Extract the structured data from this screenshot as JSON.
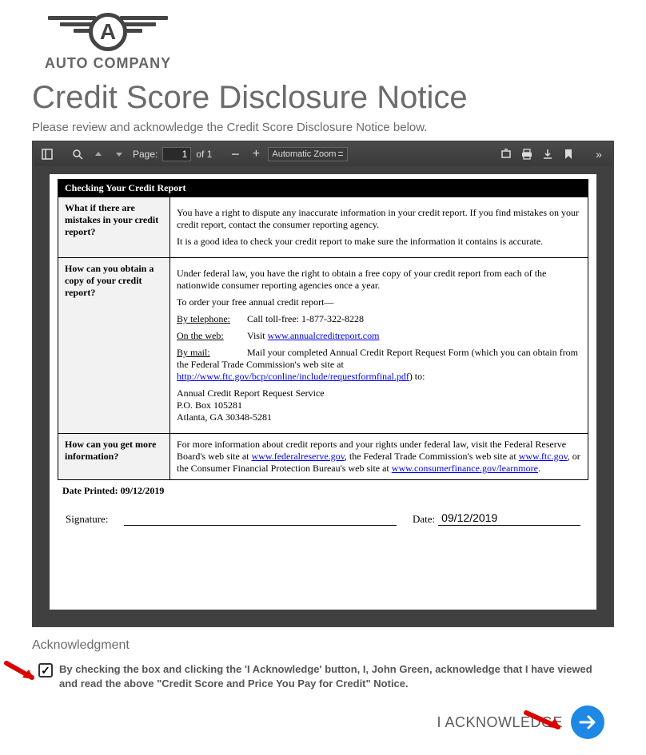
{
  "logo": {
    "letter": "A",
    "company": "AUTO COMPANY"
  },
  "header": {
    "title": "Credit Score Disclosure Notice",
    "subtitle": "Please review and acknowledge the Credit Score Disclosure Notice below."
  },
  "pdf_toolbar": {
    "page_label": "Page:",
    "page_value": "1",
    "page_of": "of 1",
    "zoom_selected": "Automatic Zoom"
  },
  "document": {
    "section_header": "Checking Your Credit Report",
    "rows": [
      {
        "label": "What if there are mistakes in your credit report?",
        "p1": "You have a right to dispute any inaccurate information in your credit report.  If you find mistakes on your credit report, contact the consumer reporting agency.",
        "p2": "It is a good idea to check your credit report to make sure the information it contains is accurate."
      },
      {
        "label": "How can you obtain a copy of your credit report?",
        "intro": "Under federal law, you have the right to obtain a free copy of your credit report from each of the nationwide consumer reporting agencies once a year.",
        "order": "To order your free annual credit report—",
        "tel_label": "By telephone:",
        "tel_text": "Call toll-free:  1-877-322-8228",
        "web_label": "On the web:",
        "web_text": "Visit ",
        "web_link": "www.annualcreditreport.com",
        "mail_label": "By mail:",
        "mail_text": "Mail your completed Annual Credit Report Request Form (which you can obtain from the Federal Trade Commission's web site at ",
        "mail_link": "http://www.ftc.gov/bcp/conline/include/requestformfinal.pdf",
        "mail_after": ") to:",
        "addr1": "Annual Credit Report Request Service",
        "addr2": "P.O. Box 105281",
        "addr3": "Atlanta, GA 30348-5281"
      },
      {
        "label": "How can you get more information?",
        "text1": "For more information about credit reports and your rights under federal law, visit the Federal Reserve Board's web site at ",
        "link1": "www.federalreserve.gov",
        "text2": ", the Federal Trade Commission's web site at ",
        "link2": "www.ftc.gov",
        "text3": ", or the Consumer Financial Protection Bureau's web site at ",
        "link3": "www.consumerfinance.gov/learnmore",
        "text4": "."
      }
    ],
    "date_printed_label": "Date Printed: ",
    "date_printed": "09/12/2019",
    "signature_label": "Signature:",
    "date_label": "Date:",
    "date_value": "09/12/2019"
  },
  "ack": {
    "title": "Acknowledgment",
    "checked": true,
    "text_before": "By checking the box and clicking the 'I Acknowledge' button, I, John",
    "name_green": "Green",
    "text_after": ", acknowledge that I have viewed and read the above \"Credit Score and Price You Pay for Credit\" Notice.",
    "button_label": "I ACKNOWLEDGE"
  }
}
